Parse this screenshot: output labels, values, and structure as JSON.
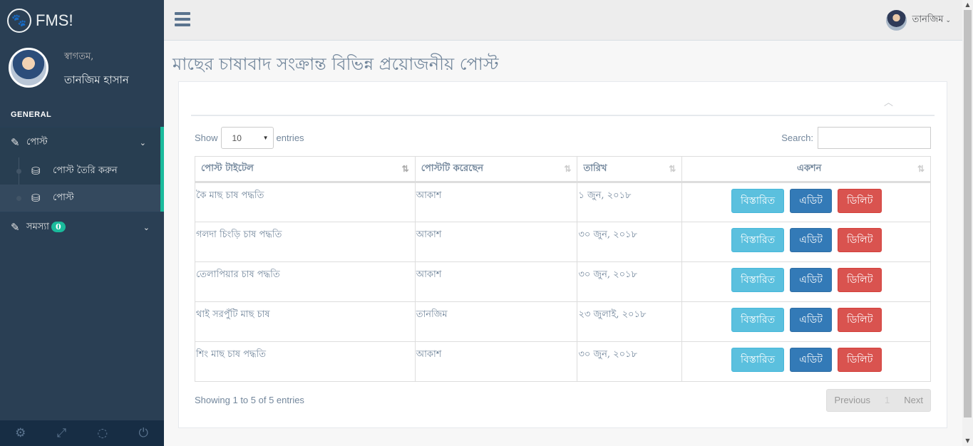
{
  "brand": {
    "name": "FMS!",
    "icon": "paw-icon"
  },
  "profile": {
    "welcome": "স্বাগতম,",
    "name": "তানজিম হাসান"
  },
  "sidebar": {
    "section_title": "GENERAL",
    "menus": [
      {
        "label": "পোস্ট",
        "icon": "edit-icon",
        "items": [
          {
            "label": "পোস্ট তৈরি করুন",
            "icon": "database-icon"
          },
          {
            "label": "পোস্ট",
            "icon": "database-icon"
          }
        ]
      },
      {
        "label": "সমস্যা",
        "icon": "edit-icon",
        "badge": "0"
      }
    ],
    "footer_icons": [
      "gear-icon",
      "fullscreen-icon",
      "eye-slash-icon",
      "power-icon"
    ]
  },
  "topnav": {
    "user_name": "তানজিম"
  },
  "page": {
    "title": "মাছের চাষাবাদ সংক্রান্ত বিভিন্ন প্রয়োজনীয় পোস্ট"
  },
  "table_controls": {
    "show_label": "Show",
    "length_value": "10",
    "entries_label": "entries",
    "search_label": "Search:",
    "search_value": ""
  },
  "table": {
    "headers": [
      "পোস্ট টাইটেল",
      "পোস্টটি করেছেন",
      "তারিখ",
      "একশন"
    ],
    "rows": [
      {
        "title": "কৈ মাছ চাষ পদ্ধতি",
        "author": "আকাশ",
        "date": "১ জুন, ২০১৮"
      },
      {
        "title": "গলদা চিংড়ি চাষ পদ্ধতি",
        "author": "আকাশ",
        "date": "৩০ জুন, ২০১৮"
      },
      {
        "title": "তেলাপিয়ার চাষ পদ্ধতি",
        "author": "আকাশ",
        "date": "৩০ জুন, ২০১৮"
      },
      {
        "title": "থাই সরপুঁটি মাছ চাষ",
        "author": "তানজিম",
        "date": "২৩ জুলাই, ২০১৮"
      },
      {
        "title": "শিং মাছ চাষ পদ্ধতি",
        "author": "আকাশ",
        "date": "৩০ জুন, ২০১৮"
      }
    ],
    "actions": {
      "details": "বিস্তারিত",
      "edit": "এডিট",
      "delete": "ডিলিট"
    }
  },
  "footer": {
    "info": "Showing 1 to 5 of 5 entries",
    "previous": "Previous",
    "current_page": "1",
    "next": "Next"
  },
  "colors": {
    "sidebar": "#2a3f54",
    "accent": "#1abb9c",
    "info": "#5bc0de",
    "primary": "#337ab7",
    "danger": "#d9534f"
  }
}
